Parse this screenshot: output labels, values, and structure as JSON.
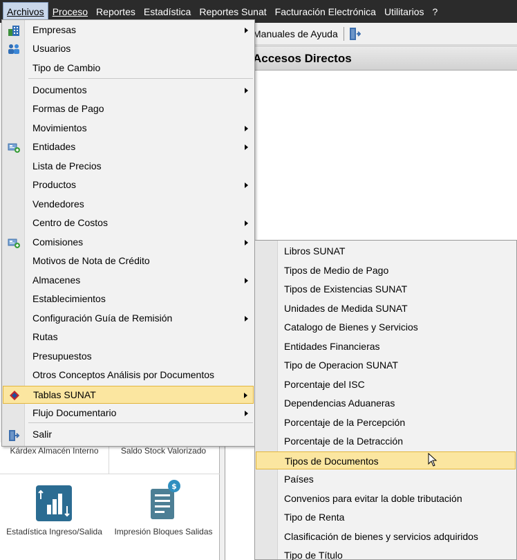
{
  "menubar": {
    "items": [
      {
        "label": "Archivos",
        "active": true
      },
      {
        "label": "Proceso"
      },
      {
        "label": "Reportes"
      },
      {
        "label": "Estadística"
      },
      {
        "label": "Reportes Sunat"
      },
      {
        "label": "Facturación Electrónica"
      },
      {
        "label": "Utilitarios"
      },
      {
        "label": "?"
      }
    ]
  },
  "toolbar": {
    "manuales_label": "Manuales de Ayuda"
  },
  "accesos": {
    "title": "Accesos Directos"
  },
  "tiles": {
    "kardex": "Kárdex Almacén Interno",
    "saldo": "Saldo Stock Valorizado",
    "estadistica": "Estadística Ingreso/Salida",
    "impresion": "Impresión Bloques Salidas"
  },
  "archivos_menu": {
    "items": [
      {
        "label": "Empresas",
        "icon": "building-icon",
        "submenu": true
      },
      {
        "label": "Usuarios",
        "icon": "users-icon",
        "submenu": false
      },
      {
        "label": "Tipo de Cambio",
        "submenu": false
      },
      {
        "label": "Documentos",
        "submenu": true
      },
      {
        "label": "Formas de Pago",
        "submenu": false
      },
      {
        "label": "Movimientos",
        "submenu": true
      },
      {
        "label": "Entidades",
        "icon": "entity-icon",
        "submenu": true
      },
      {
        "label": "Lista de Precios",
        "submenu": false
      },
      {
        "label": "Productos",
        "submenu": true
      },
      {
        "label": "Vendedores",
        "submenu": false
      },
      {
        "label": "Centro de Costos",
        "submenu": true
      },
      {
        "label": "Comisiones",
        "icon": "entity-icon",
        "submenu": true
      },
      {
        "label": "Motivos de Nota de Crédito",
        "submenu": false
      },
      {
        "label": "Almacenes",
        "submenu": true
      },
      {
        "label": "Establecimientos",
        "submenu": false
      },
      {
        "label": "Configuración Guía de Remisión",
        "submenu": true
      },
      {
        "label": "Rutas",
        "submenu": false
      },
      {
        "label": "Presupuestos",
        "submenu": false
      },
      {
        "label": "Otros Conceptos Análisis por Documentos",
        "submenu": false
      },
      {
        "label": "Tablas SUNAT",
        "icon": "sunat-icon",
        "submenu": true,
        "highlighted": true
      },
      {
        "label": "Flujo Documentario",
        "submenu": true
      },
      {
        "label": "Salir",
        "icon": "exit-door-icon",
        "submenu": false
      }
    ]
  },
  "tablas_sunat_submenu": {
    "items": [
      {
        "label": "Libros SUNAT"
      },
      {
        "label": "Tipos de Medio de Pago"
      },
      {
        "label": "Tipos de Existencias SUNAT"
      },
      {
        "label": "Unidades de Medida SUNAT"
      },
      {
        "label": "Catalogo de Bienes y Servicios"
      },
      {
        "label": "Entidades Financieras"
      },
      {
        "label": "Tipo de Operacion SUNAT"
      },
      {
        "label": "Porcentaje del ISC"
      },
      {
        "label": "Dependencias Aduaneras"
      },
      {
        "label": "Porcentaje de la Percepción"
      },
      {
        "label": "Porcentaje de la Detracción"
      },
      {
        "label": "Tipos de Documentos",
        "highlighted": true
      },
      {
        "label": "Países"
      },
      {
        "label": "Convenios para evitar la doble tributación"
      },
      {
        "label": "Tipo de Renta"
      },
      {
        "label": "Clasificación de bienes y servicios adquiridos"
      },
      {
        "label": "Tipo de Título"
      }
    ]
  },
  "colors": {
    "menubar_bg": "#2b2b2b",
    "highlight_bg": "#fbe6a0",
    "highlight_border": "#e2b53c",
    "menu_bg": "#f2f2f2"
  }
}
